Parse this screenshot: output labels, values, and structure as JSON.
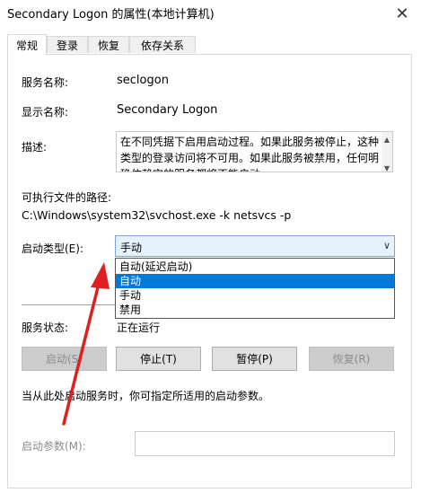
{
  "window": {
    "title": "Secondary Logon 的属性(本地计算机)",
    "close_symbol": "✕"
  },
  "tabs": [
    {
      "label": "常规",
      "active": true
    },
    {
      "label": "登录",
      "active": false
    },
    {
      "label": "恢复",
      "active": false
    },
    {
      "label": "依存关系",
      "active": false
    }
  ],
  "general": {
    "service_name_label": "服务名称:",
    "service_name_value": "seclogon",
    "display_name_label": "显示名称:",
    "display_name_value": "Secondary Logon",
    "description_label": "描述:",
    "description_text": "在不同凭据下启用启动过程。如果此服务被停止，这种类型的登录访问将不可用。如果此服务被禁用，任何明确依赖它的服务都将不能启动。",
    "exe_path_label": "可执行文件的路径:",
    "exe_path_value": "C:\\Windows\\system32\\svchost.exe -k netsvcs -p",
    "startup_type_label": "启动类型(E):",
    "startup_type_value": "手动",
    "startup_options": [
      {
        "label": "自动(延迟启动)",
        "selected": false
      },
      {
        "label": "自动",
        "selected": true
      },
      {
        "label": "手动",
        "selected": false
      },
      {
        "label": "禁用",
        "selected": false
      }
    ],
    "service_status_label": "服务状态:",
    "service_status_value": "正在运行",
    "buttons": {
      "start": "启动(S)",
      "stop": "停止(T)",
      "pause": "暂停(P)",
      "resume": "恢复(R)"
    },
    "hint_text": "当从此处启动服务时，你可指定所适用的启动参数。",
    "start_params_label": "启动参数(M):",
    "start_params_value": ""
  },
  "colors": {
    "selected_option_bg": "#0078d7",
    "annotation_arrow": "#e02020"
  }
}
